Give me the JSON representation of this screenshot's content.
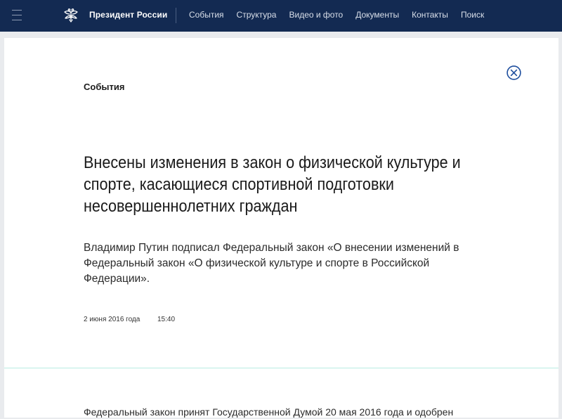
{
  "header": {
    "brand": "Президент России",
    "nav": [
      "События",
      "Структура",
      "Видео и фото",
      "Документы",
      "Контакты",
      "Поиск"
    ]
  },
  "article": {
    "section": "События",
    "title": "Внесены изменения в закон о физической культуре и спорте, касающиеся спортивной подготовки несовершеннолетних граждан",
    "lead": "Владимир Путин подписал Федеральный закон «О внесении изменений в Федеральный закон «О физической культуре и спорте в Российской Федерации».",
    "date": "2 июня 2016 года",
    "time": "15:40",
    "body_first_line": "Федеральный закон принят Государственной Думой 20 мая 2016 года и одобрен"
  },
  "colors": {
    "header_bg": "#132a52",
    "accent": "#1f4f9e",
    "separator": "#b9ece2"
  },
  "icons": {
    "menu": "hamburger-menu-icon",
    "emblem": "double-headed-eagle-emblem",
    "close": "close-circle-icon"
  }
}
